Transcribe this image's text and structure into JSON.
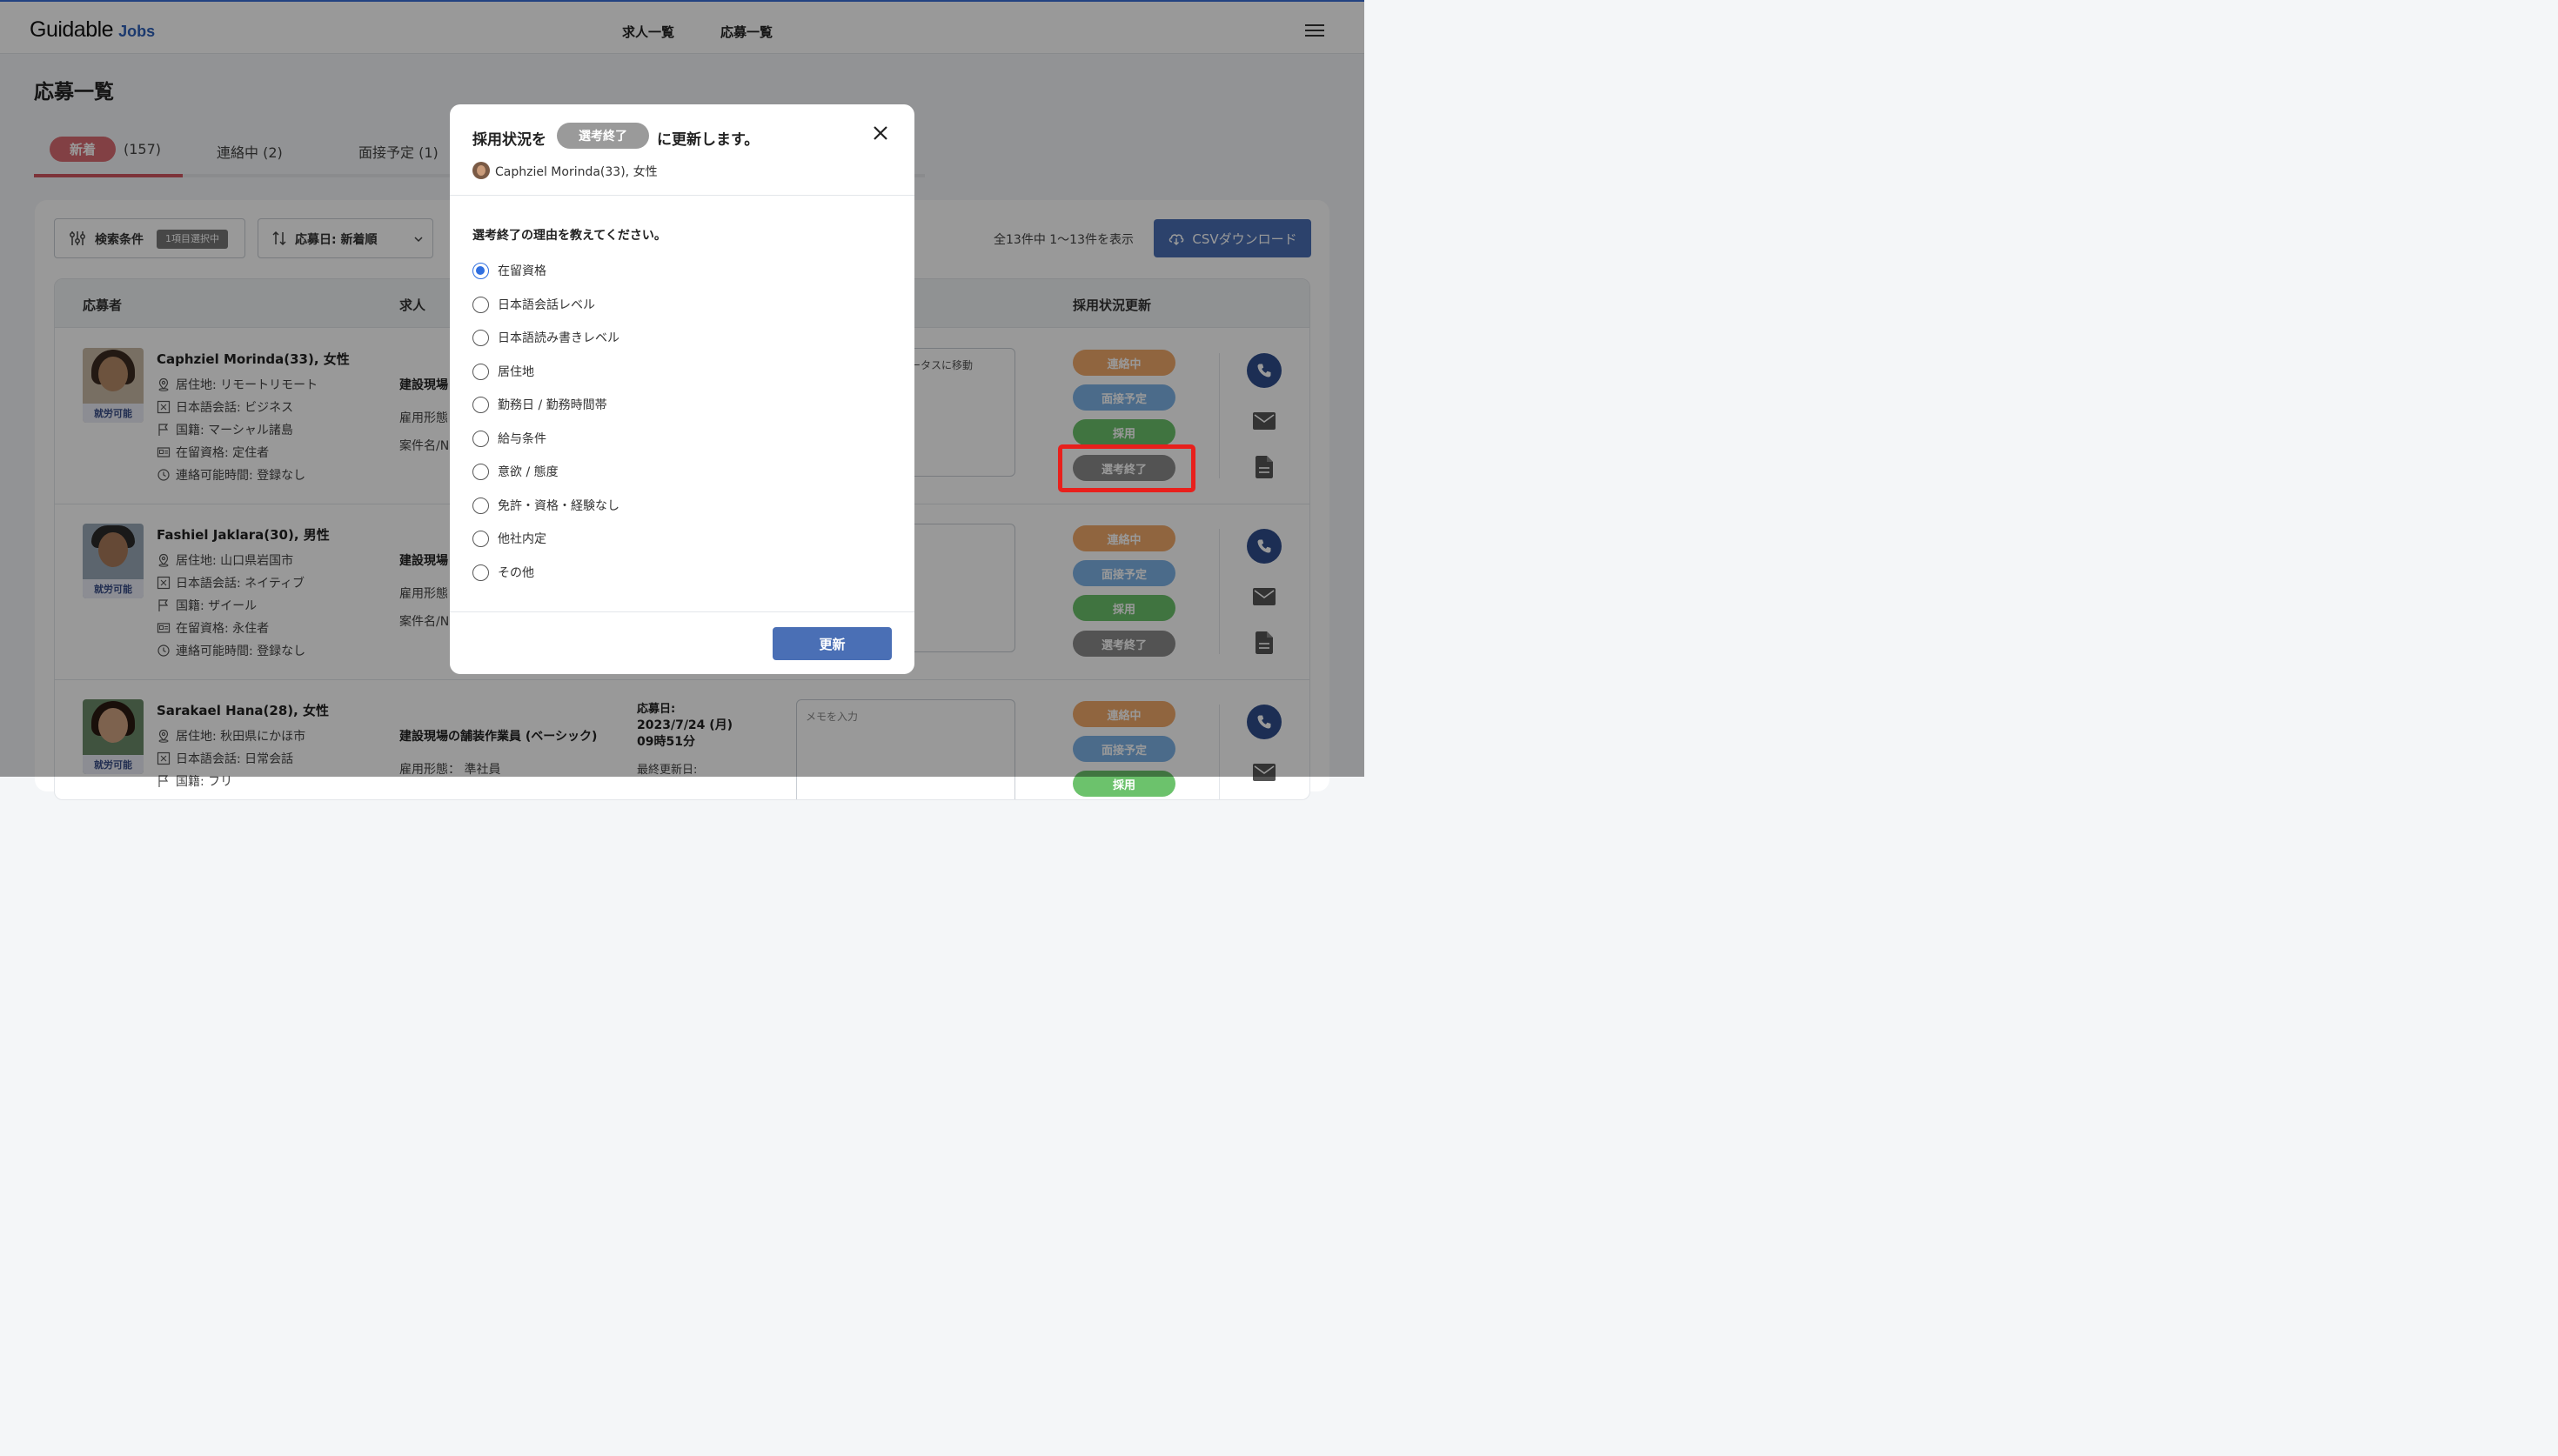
{
  "header": {
    "logo_main": "Guidable",
    "logo_sub": "Jobs",
    "nav": [
      "求人一覧",
      "応募一覧"
    ]
  },
  "page": {
    "title": "応募一覧",
    "tabs": [
      {
        "label": "新着",
        "count": "(157)"
      },
      {
        "label": "連絡中",
        "count": "(2)"
      },
      {
        "label": "面接予定",
        "count": "(1)"
      }
    ]
  },
  "toolbar": {
    "filter_label": "検索条件",
    "filter_chip": "1項目選択中",
    "sort_label": "応募日: 新着順",
    "count_text": "全13件中 1〜13件を表示",
    "csv_label": "CSVダウンロード"
  },
  "table": {
    "headers": {
      "applicant": "応募者",
      "job": "求人",
      "status": "採用状況更新"
    },
    "work_badge": "就労可能",
    "status_labels": {
      "contact": "連絡中",
      "interview": "面接予定",
      "hire": "採用",
      "end": "選考終了"
    },
    "rows": [
      {
        "name": "Caphziel Morinda(33), 女性",
        "residence": "居住地: リモートリモート",
        "language": "日本語会話: ビジネス",
        "nationality": "国籍: マーシャル諸島",
        "visa": "在留資格: 定住者",
        "contact_time": "連絡可能時間: 登録なし",
        "job_title": "建設現場",
        "job_type": "雇用形態",
        "job_case": "案件名/N",
        "memo": "ータスに移動"
      },
      {
        "name": "Fashiel Jaklara(30), 男性",
        "residence": "居住地: 山口県岩国市",
        "language": "日本語会話: ネイティブ",
        "nationality": "国籍: ザイール",
        "visa": "在留資格: 永住者",
        "contact_time": "連絡可能時間: 登録なし",
        "job_title": "建設現場",
        "job_type": "雇用形態",
        "job_case": "案件名/N",
        "memo": ""
      },
      {
        "name": "Sarakael Hana(28), 女性",
        "residence": "居住地: 秋田県にかほ市",
        "language": "日本語会話: 日常会話",
        "nationality": "国籍: フリ",
        "job_title": "建設現場の舗装作業員 (ベーシック)",
        "job_type": "雇用形態： 準社員",
        "applied_label": "応募日:",
        "applied_date": "2023/7/24 (月)",
        "applied_time": "09時51分",
        "updated_label": "最終更新日:",
        "memo_placeholder": "メモを入力"
      }
    ]
  },
  "modal": {
    "title_prefix": "採用状況を",
    "status_pill": "選考終了",
    "title_suffix": "に更新します。",
    "applicant": "Caphziel Morinda(33), 女性",
    "question": "選考終了の理由を教えてください。",
    "options": [
      "在留資格",
      "日本語会話レベル",
      "日本語読み書きレベル",
      "居住地",
      "勤務日 / 勤務時間帯",
      "給与条件",
      "意欲 / 態度",
      "免許・資格・経験なし",
      "他社内定",
      "その他"
    ],
    "selected_index": 0,
    "submit_label": "更新"
  },
  "colors": {
    "accent_red": "#d96b72",
    "primary_blue": "#4a6fb5",
    "radio_blue": "#2f6fe0",
    "highlight_red": "#e8201c"
  }
}
